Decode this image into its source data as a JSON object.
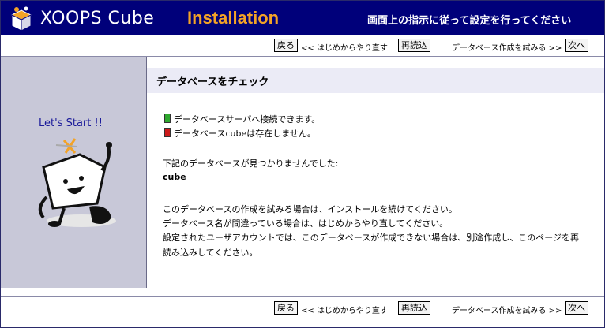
{
  "header": {
    "brand": "XOOPS Cube",
    "product": "Installation",
    "instruction": "画面上の指示に従って設定を行ってください"
  },
  "nav": {
    "back_label": "戻る",
    "restart_text": "<< はじめからやり直す",
    "reload_label": "再読込",
    "next_text": "データベース作成を試みる >>",
    "next_label": "次へ"
  },
  "sidebar": {
    "greeting": "Let's Start !!"
  },
  "main": {
    "title": "データベースをチェック",
    "status": [
      {
        "text": "データベースサーバへ接続できます。",
        "color": "#2ea82e"
      },
      {
        "text": "データベースcubeは存在しません。",
        "color": "#cc1a1a"
      }
    ],
    "not_found_text": "下記のデータベースが見つかりませんでした:",
    "db_name": "cube",
    "paragraphs": [
      "このデータベースの作成を試みる場合は、インストールを続けてください。",
      "データベース名が間違っている場合は、はじめからやり直してください。",
      "設定されたユーザアカウントでは、このデータベースが作成できない場合は、別途作成し、このページを再",
      "読み込みしてください。"
    ]
  },
  "colors": {
    "header_bg": "#00007a",
    "accent": "#f3a327",
    "sidebar_bg": "#c8c8d8",
    "title_bg": "#ebebf6"
  }
}
